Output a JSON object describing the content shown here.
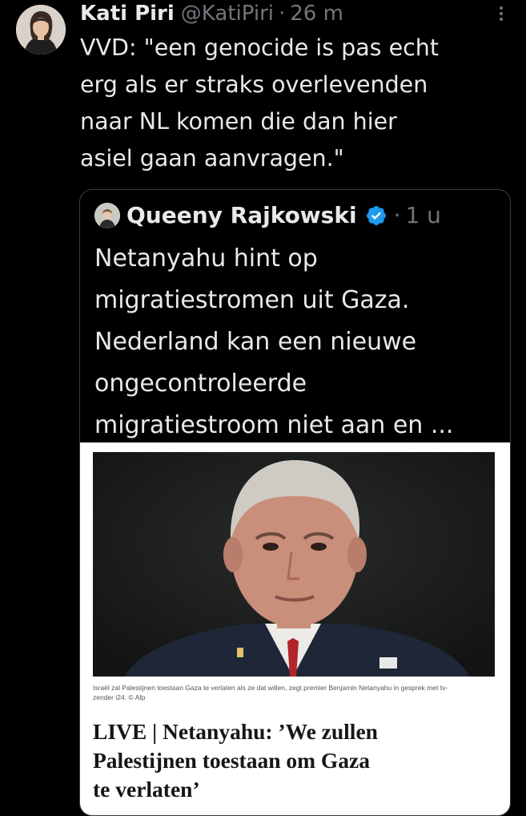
{
  "tweet": {
    "author_name": "Kati Piri",
    "author_handle": "@KatiPiri",
    "separator": "·",
    "time": "26 m",
    "text_lines": [
      "VVD: \"een genocide is pas echt",
      "erg als er straks overlevenden",
      "naar NL komen die dan hier",
      "asiel gaan aanvragen.\""
    ],
    "more_icon": "more-vertical-icon"
  },
  "quote": {
    "author_name": "Queeny Rajkowski",
    "verified_icon": "verified-badge-icon",
    "separator": "·",
    "time": "1 u",
    "text_lines": [
      "Netanyahu hint op",
      "migratiestromen uit Gaza.",
      "Nederland kan een nieuwe",
      "ongecontroleerde",
      "migratiestroom niet aan en ..."
    ],
    "article": {
      "caption_lines": [
        "Israël zal Palestijnen toestaan Gaza te verlaten als ze dat willen, zegt premier Benjamin Netanyahu in gesprek met tv-",
        "zender i24. © Afp"
      ],
      "headline_lines": [
        "LIVE | Netanyahu: ’We zullen",
        "Palestijnen toestaan om Gaza",
        "te verlaten’"
      ]
    }
  },
  "colors": {
    "background": "#000000",
    "text": "#e7e9ea",
    "muted": "#71767b",
    "verified": "#1d9bf0",
    "card_border": "#3a3d41"
  }
}
